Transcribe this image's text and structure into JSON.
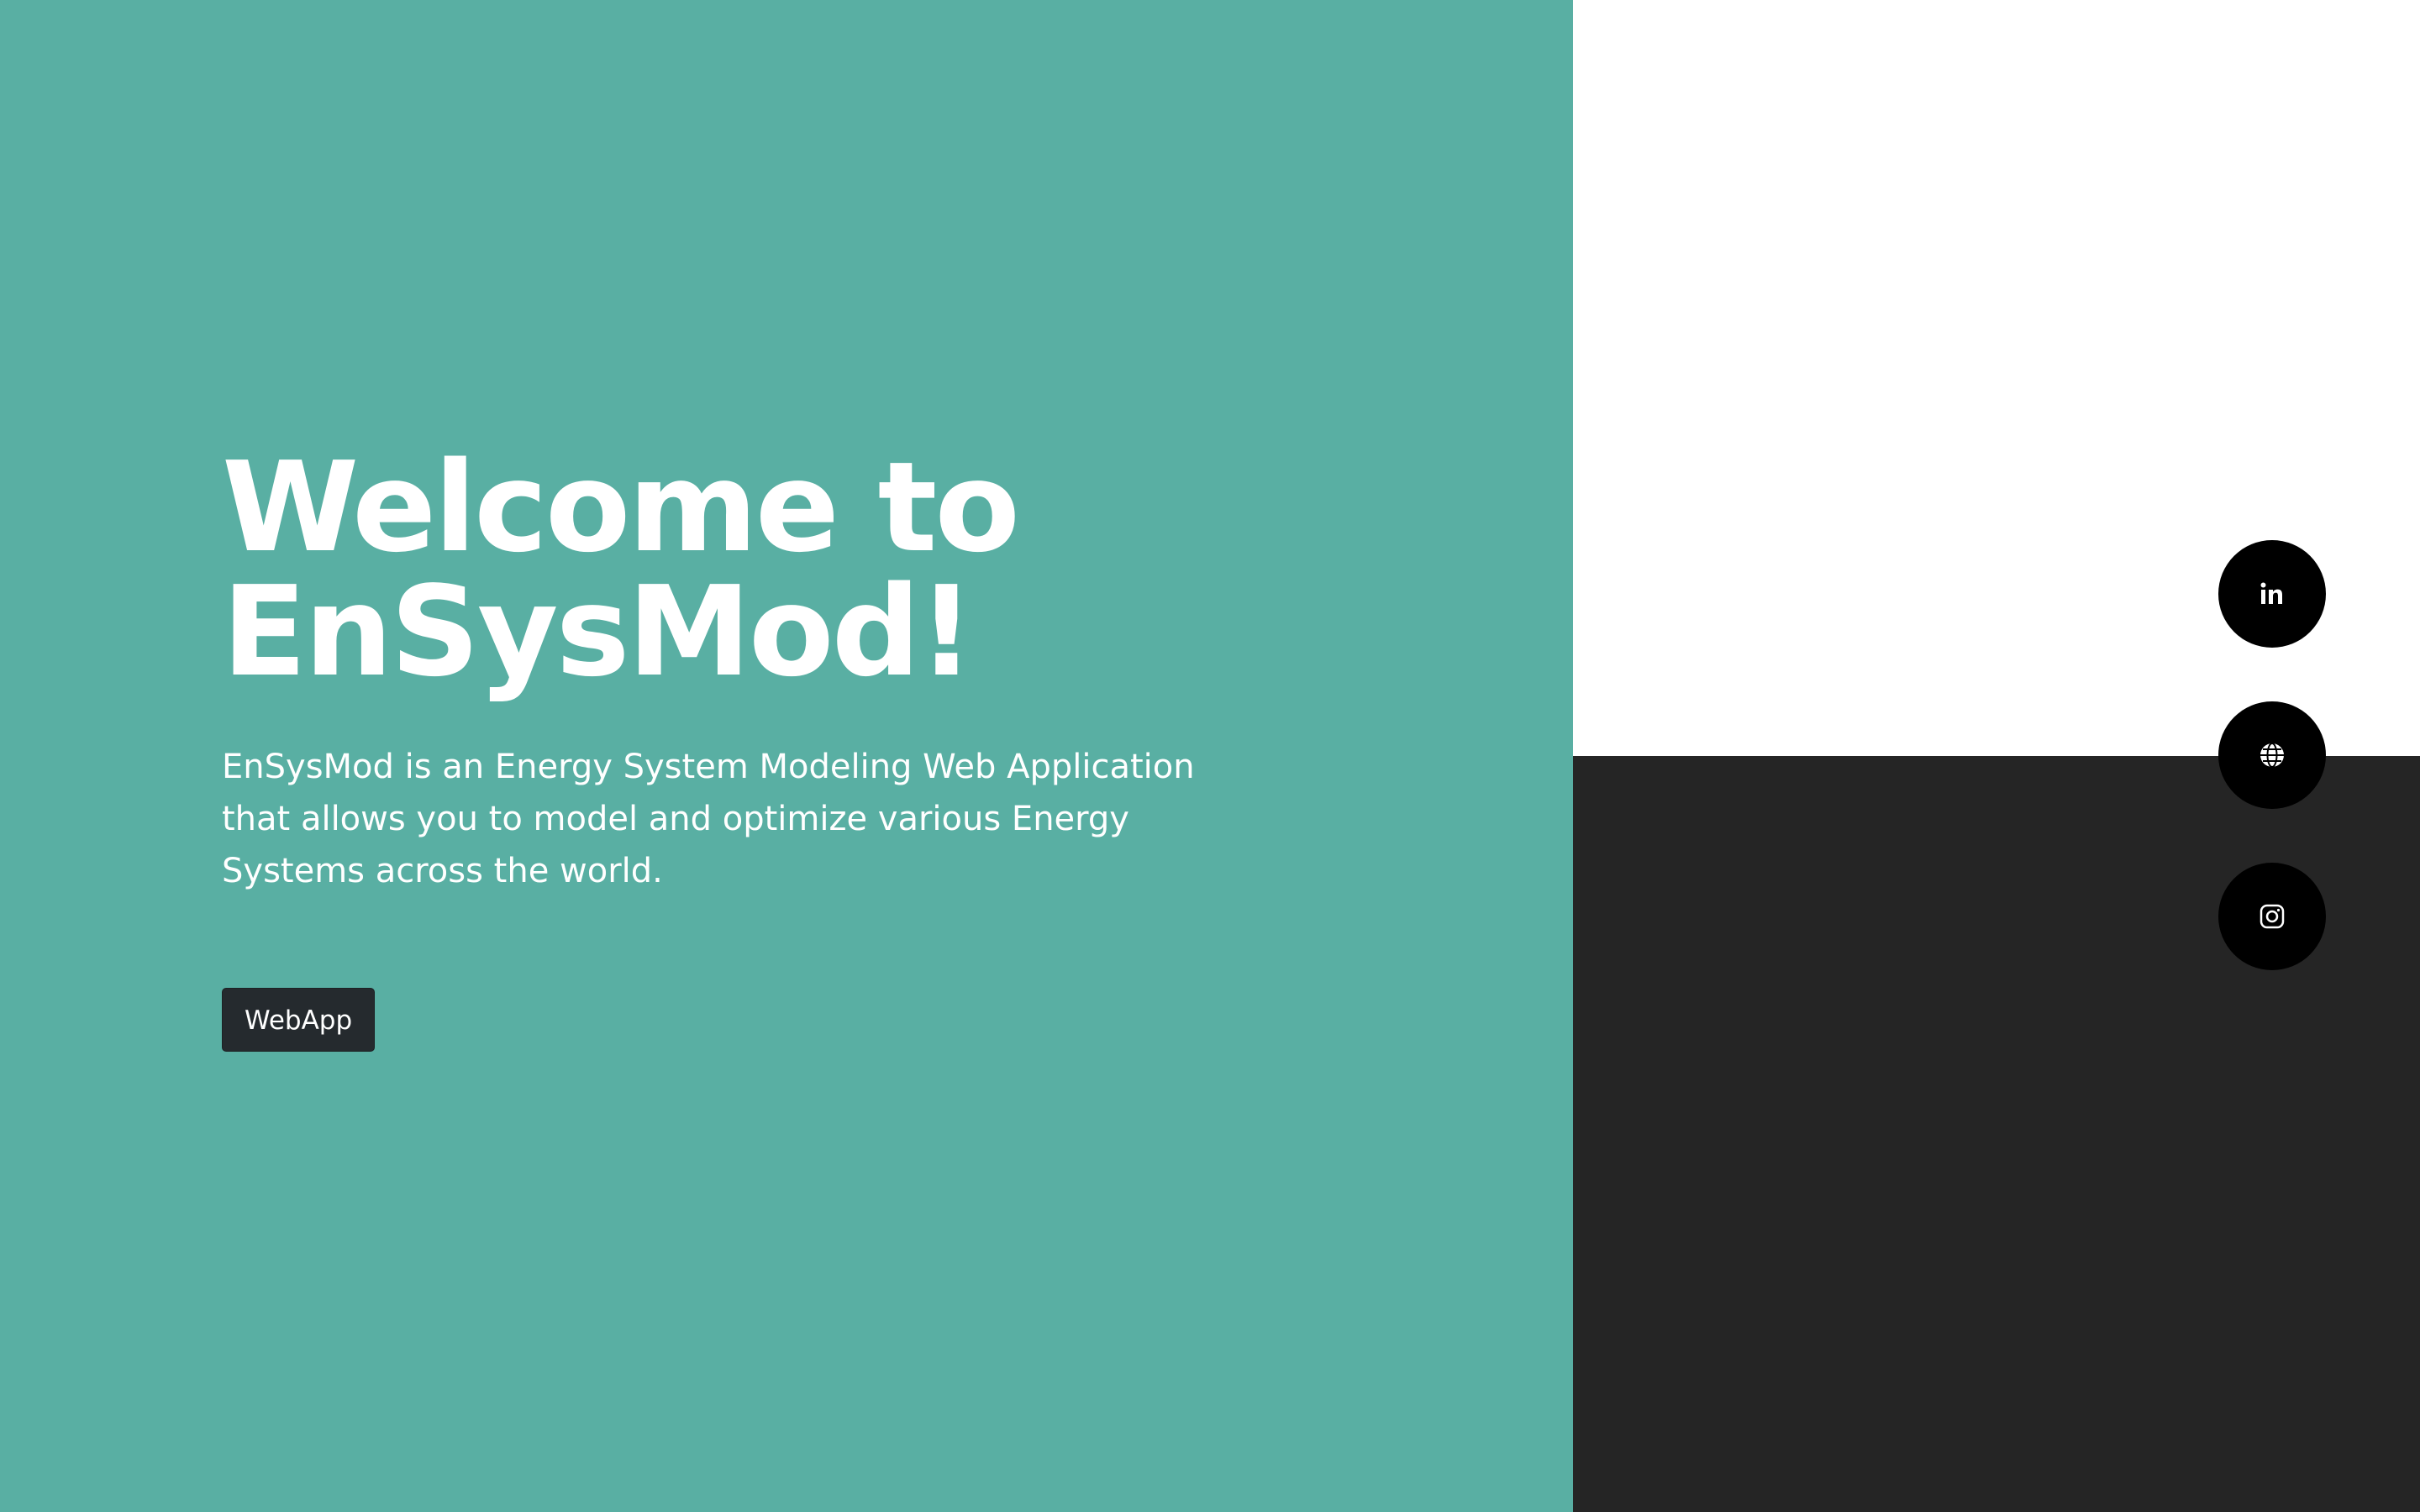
{
  "hero": {
    "title_line1": "Welcome to",
    "title_line2": "EnSysMod!",
    "description": "EnSysMod is an Energy System Modeling Web Application that allows you to model and optimize various Energy Systems across the world.",
    "button_label": "WebApp"
  },
  "social": [
    {
      "icon": "linkedin-icon"
    },
    {
      "icon": "globe-icon"
    },
    {
      "icon": "instagram-icon"
    }
  ],
  "colors": {
    "accent_teal": "#59afa3",
    "dark_panel": "#252525",
    "button_bg": "#252a2e",
    "social_bg": "#000000"
  }
}
